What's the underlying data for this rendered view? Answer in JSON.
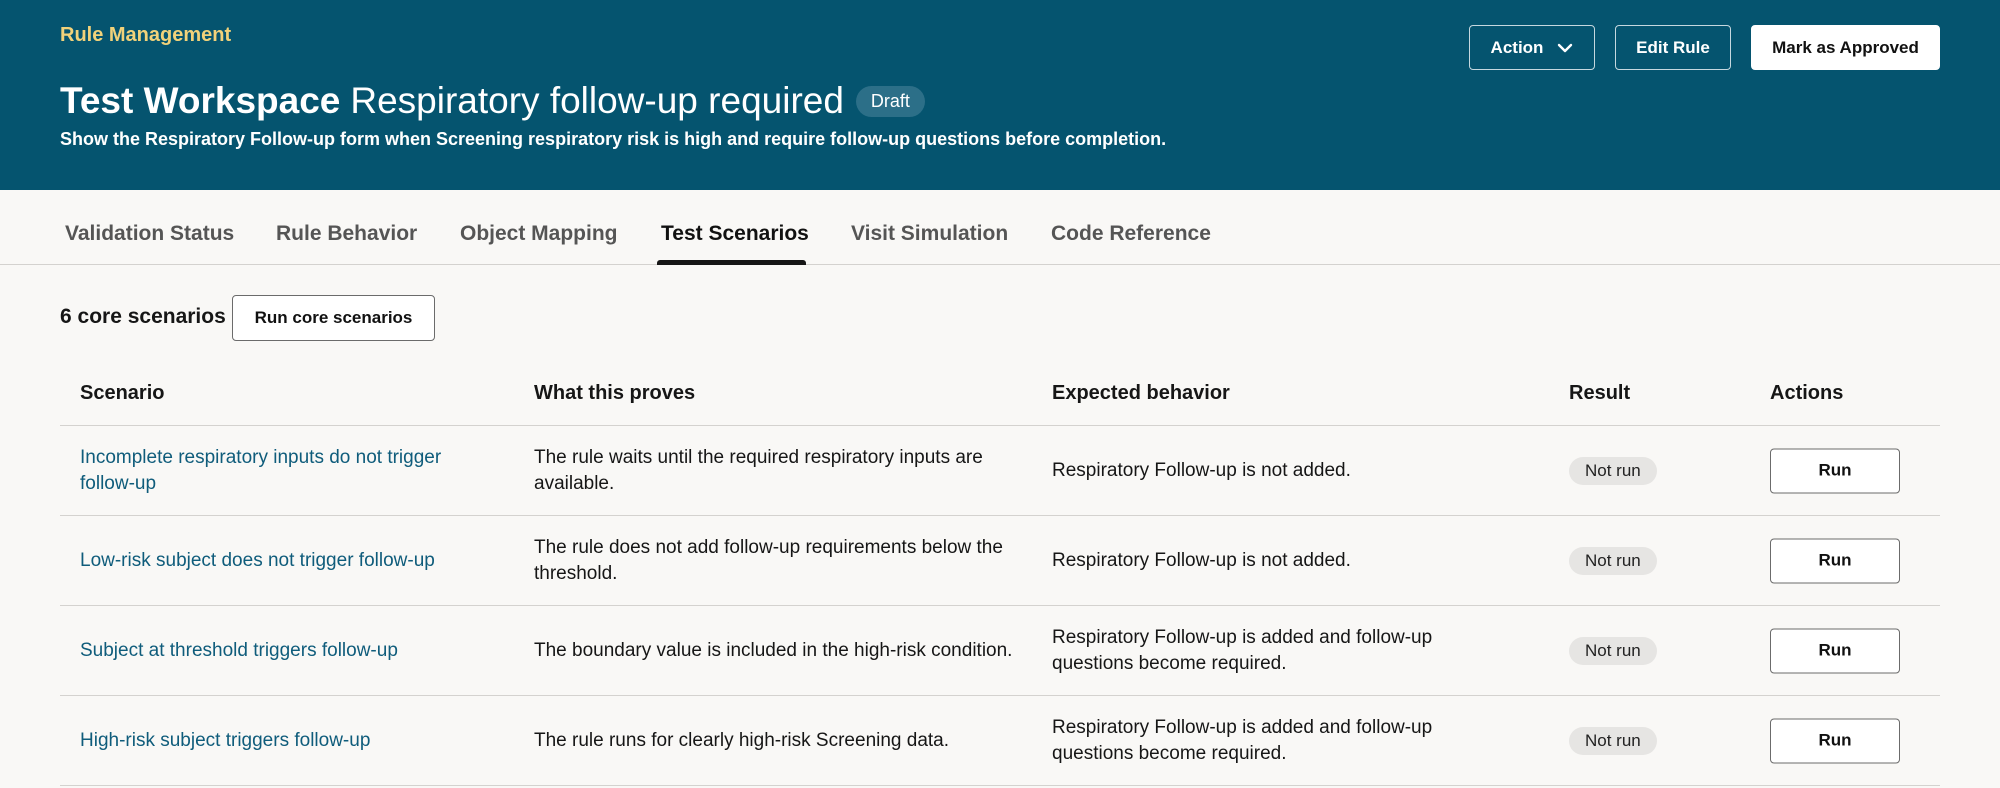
{
  "header": {
    "breadcrumb": "Rule Management",
    "workspace": "Test Workspace",
    "rule_name": "Respiratory follow-up required",
    "status_badge": "Draft",
    "subtitle": "Show the Respiratory Follow-up form when Screening respiratory risk is high and require follow-up questions before completion.",
    "action_label": "Action",
    "action_icon": "chevron-down-icon",
    "edit_label": "Edit Rule",
    "approve_label": "Mark as Approved"
  },
  "tabs": [
    {
      "label": "Validation Status"
    },
    {
      "label": "Rule Behavior"
    },
    {
      "label": "Object Mapping"
    },
    {
      "label": "Test Scenarios",
      "active": true
    },
    {
      "label": "Visit Simulation"
    },
    {
      "label": "Code Reference"
    }
  ],
  "scenarios": {
    "count_label": "6 core scenarios",
    "run_all_label": "Run core scenarios",
    "columns": [
      "Scenario",
      "What this proves",
      "Expected behavior",
      "Result",
      "Actions"
    ],
    "rows": [
      {
        "scenario": "Incomplete respiratory inputs do not trigger follow-up",
        "proves": "The rule waits until the required respiratory inputs are available.",
        "expected": "Respiratory Follow-up is not added.",
        "result": "Not run",
        "action": "Run"
      },
      {
        "scenario": "Low-risk subject does not trigger follow-up",
        "proves": "The rule does not add follow-up requirements below the threshold.",
        "expected": "Respiratory Follow-up is not added.",
        "result": "Not run",
        "action": "Run"
      },
      {
        "scenario": "Subject at threshold triggers follow-up",
        "proves": "The boundary value is included in the high-risk condition.",
        "expected": "Respiratory Follow-up is added and follow-up questions become required.",
        "result": "Not run",
        "action": "Run"
      },
      {
        "scenario": "High-risk subject triggers follow-up",
        "proves": "The rule runs for clearly high-risk Screening data.",
        "expected": "Respiratory Follow-up is added and follow-up questions become required.",
        "result": "Not run",
        "action": "Run"
      }
    ]
  }
}
